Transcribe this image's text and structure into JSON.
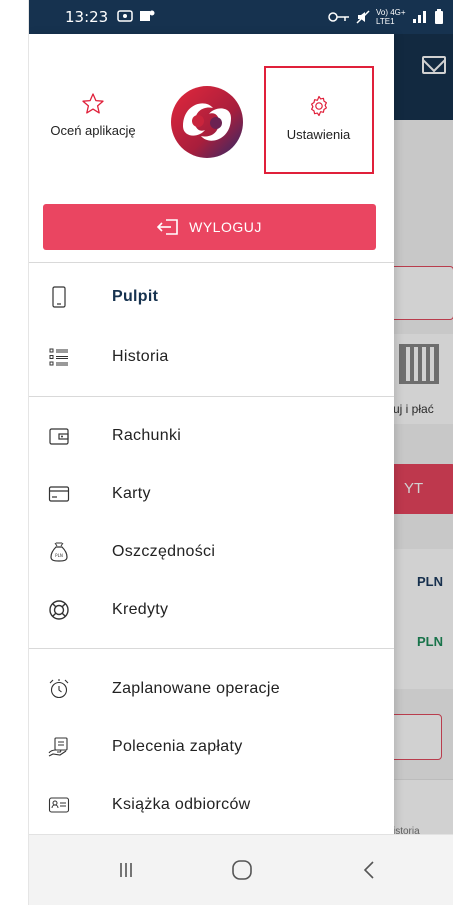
{
  "status_bar": {
    "time": "13:23",
    "right_text": "Vo) 4G+ LTE1"
  },
  "drawer": {
    "rate_app_label": "Oceń aplikację",
    "settings_label": "Ustawienia",
    "logout_label": "WYLOGUJ",
    "menu": [
      {
        "label": "Pulpit",
        "icon": "phone-icon",
        "active": true
      },
      {
        "label": "Historia",
        "icon": "history-list-icon",
        "active": false
      },
      {
        "label": "Rachunki",
        "icon": "wallet-icon",
        "active": false
      },
      {
        "label": "Karty",
        "icon": "credit-card-icon",
        "active": false
      },
      {
        "label": "Oszczędności",
        "icon": "savings-bag-icon",
        "active": false
      },
      {
        "label": "Kredyty",
        "icon": "lifebuoy-icon",
        "active": false
      },
      {
        "label": "Zaplanowane operacje",
        "icon": "alarm-clock-icon",
        "active": false
      },
      {
        "label": "Polecenia zapłaty",
        "icon": "payment-order-icon",
        "active": false
      },
      {
        "label": "Książka odbiorców",
        "icon": "address-book-icon",
        "active": false
      }
    ]
  },
  "background": {
    "qr_label": "uj i płać",
    "red_button": "YT",
    "amount_1": "PLN",
    "amount_2": "PLN",
    "history_label": "istoria"
  },
  "colors": {
    "primary_navy": "#16324f",
    "accent_red": "#ea4561",
    "highlight_box": "#e0203a"
  }
}
